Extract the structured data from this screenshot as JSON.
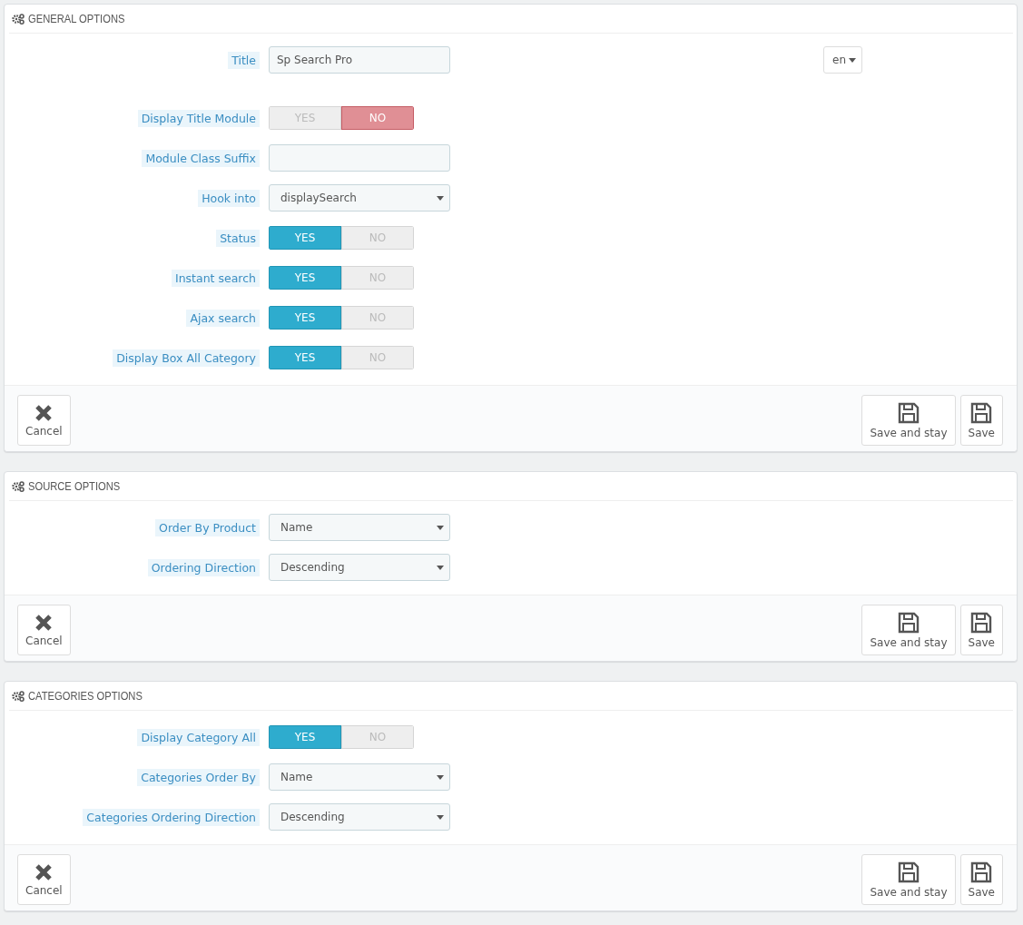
{
  "panels": [
    {
      "title": "GENERAL OPTIONS",
      "fields": [
        {
          "kind": "text",
          "label": "Title",
          "value": "Sp Search Pro",
          "language": "en"
        },
        {
          "kind": "toggle",
          "label": "Display Title Module",
          "yes": "YES",
          "no": "NO",
          "on": false
        },
        {
          "kind": "text",
          "label": "Module Class Suffix"
        },
        {
          "kind": "select",
          "label": "Hook into",
          "value": "displaySearch"
        },
        {
          "kind": "toggle",
          "label": "Status",
          "yes": "YES",
          "no": "NO",
          "on": true
        },
        {
          "kind": "toggle",
          "label": "Instant search",
          "yes": "YES",
          "no": "NO",
          "on": true
        },
        {
          "kind": "toggle",
          "label": "Ajax search",
          "yes": "YES",
          "no": "NO",
          "on": true
        },
        {
          "kind": "toggle",
          "label": "Display Box All Category",
          "yes": "YES",
          "no": "NO",
          "on": true
        }
      ],
      "buttons": {
        "cancel": "Cancel",
        "save_stay": "Save and stay",
        "save": "Save"
      }
    },
    {
      "title": "SOURCE OPTIONS",
      "fields": [
        {
          "kind": "select",
          "label": "Order By Product",
          "value": "Name"
        },
        {
          "kind": "select",
          "label": "Ordering Direction",
          "value": "Descending"
        }
      ],
      "buttons": {
        "cancel": "Cancel",
        "save_stay": "Save and stay",
        "save": "Save"
      }
    },
    {
      "title": "CATEGORIES OPTIONS",
      "fields": [
        {
          "kind": "toggle",
          "label": "Display Category All",
          "yes": "YES",
          "no": "NO",
          "on": true
        },
        {
          "kind": "select",
          "label": "Categories Order By",
          "value": "Name"
        },
        {
          "kind": "select",
          "label": "Categories Ordering Direction",
          "value": "Descending"
        }
      ],
      "buttons": {
        "cancel": "Cancel",
        "save_stay": "Save and stay",
        "save": "Save"
      }
    }
  ]
}
